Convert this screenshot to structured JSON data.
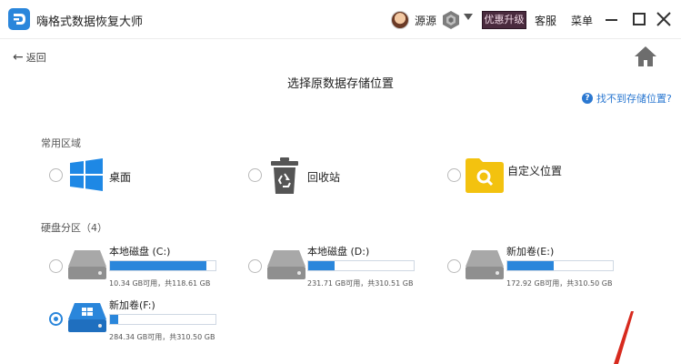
{
  "app": {
    "title": "嗨格式数据恢复大师"
  },
  "header": {
    "username": "源源",
    "upgrade_label": "优惠升级",
    "service_label": "客服",
    "menu_label": "菜单"
  },
  "nav": {
    "back_label": "返回",
    "page_title": "选择原数据存储位置",
    "help_label": "找不到存储位置?"
  },
  "common_section": {
    "label": "常用区域",
    "items": [
      {
        "label": "桌面",
        "icon": "windows-icon",
        "selected": false
      },
      {
        "label": "回收站",
        "icon": "recycle-bin-icon",
        "selected": false
      },
      {
        "label": "自定义位置",
        "icon": "folder-search-icon",
        "selected": false
      }
    ]
  },
  "disk_section": {
    "label": "硬盘分区（4）",
    "drives": [
      {
        "name": "本地磁盘 (C:)",
        "usage": "10.34 GB可用，共118.61 GB",
        "used_fraction": 0.91,
        "selected": false
      },
      {
        "name": "本地磁盘 (D:)",
        "usage": "231.71 GB可用，共310.51 GB",
        "used_fraction": 0.25,
        "selected": false
      },
      {
        "name": "新加卷(E:)",
        "usage": "172.92 GB可用，共310.50 GB",
        "used_fraction": 0.44,
        "selected": false
      },
      {
        "name": "新加卷(F:)",
        "usage": "284.34 GB可用，共310.50 GB",
        "used_fraction": 0.08,
        "selected": true
      }
    ]
  },
  "colors": {
    "accent": "#2a86db",
    "upgrade_bg": "#4a2b3e",
    "folder": "#f3c20f",
    "drive_gray": "#9b9b9b"
  }
}
